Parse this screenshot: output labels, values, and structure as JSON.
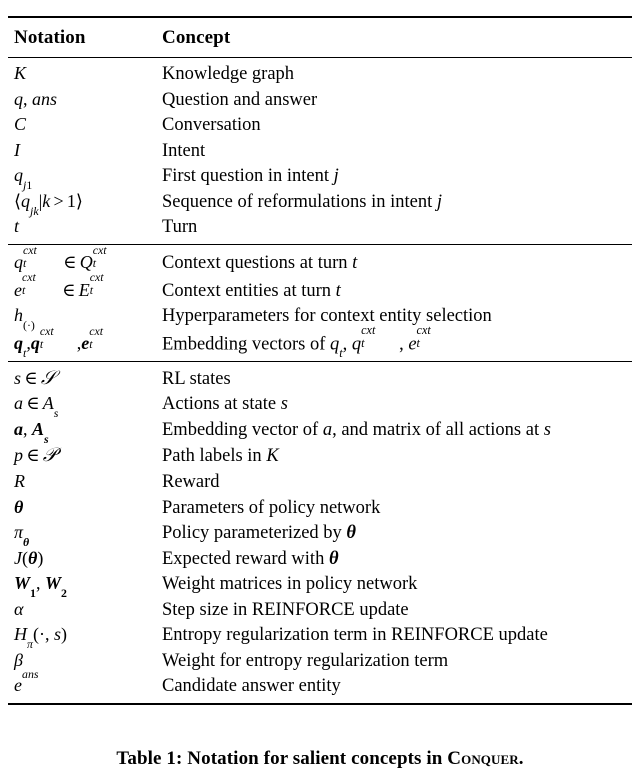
{
  "document": {
    "type": "academic-paper-table",
    "table_label": "Table 1"
  },
  "table": {
    "headers": {
      "notation": "Notation",
      "concept": "Concept"
    },
    "sections": [
      {
        "id": "conversation-basics",
        "rows": [
          {
            "notation_plain": "K",
            "concept": "Knowledge graph"
          },
          {
            "notation_plain": "q, ans",
            "concept": "Question and answer"
          },
          {
            "notation_plain": "C",
            "concept": "Conversation"
          },
          {
            "notation_plain": "I",
            "concept": "Intent"
          },
          {
            "notation_plain": "q_j1",
            "concept_prefix": "First question in intent ",
            "concept_var": "j"
          },
          {
            "notation_plain": "⟨q_jk|k > 1⟩",
            "concept_prefix": "Sequence of reformulations in intent ",
            "concept_var": "j"
          },
          {
            "notation_plain": "t",
            "concept": "Turn"
          }
        ]
      },
      {
        "id": "context-encoding",
        "rows": [
          {
            "notation_plain": "q_t^cxt ∈ Q_t^cxt",
            "concept_prefix": "Context questions at turn ",
            "concept_var": "t"
          },
          {
            "notation_plain": "e_t^cxt ∈ E_t^cxt",
            "concept_prefix": "Context entities at turn ",
            "concept_var": "t"
          },
          {
            "notation_plain": "h_(·)",
            "concept": "Hyperparameters for context entity selection"
          },
          {
            "notation_plain": "q_t, q_t^cxt, e_t^cxt",
            "concept_prefix": "Embedding vectors of ",
            "concept_math": "q_t, q_t^cxt, e_t^cxt"
          }
        ]
      },
      {
        "id": "reinforcement-learning",
        "rows": [
          {
            "notation_plain": "s ∈ S",
            "concept": "RL states"
          },
          {
            "notation_plain": "a ∈ A_s",
            "concept_prefix": "Actions at state ",
            "concept_var": "s"
          },
          {
            "notation_plain": "a, A_s",
            "concept_prefix": "Embedding vector of ",
            "concept_var1": "a",
            "concept_mid": ", and matrix of all actions at ",
            "concept_var2": "s"
          },
          {
            "notation_plain": "p ∈ P",
            "concept_prefix": "Path labels in ",
            "concept_var": "K"
          },
          {
            "notation_plain": "R",
            "concept": "Reward"
          },
          {
            "notation_plain": "θ",
            "concept": "Parameters of policy network"
          },
          {
            "notation_plain": "π_θ",
            "concept_prefix": "Policy parameterized by ",
            "concept_var": "θ"
          },
          {
            "notation_plain": "J(θ)",
            "concept_prefix": "Expected reward with ",
            "concept_var": "θ"
          },
          {
            "notation_plain": "W_1, W_2",
            "concept": "Weight matrices in policy network"
          },
          {
            "notation_plain": "α",
            "concept": "Step size in REINFORCE update"
          },
          {
            "notation_plain": "H_π(·, s)",
            "concept": "Entropy regularization term in REINFORCE update"
          },
          {
            "notation_plain": "β",
            "concept": "Weight for entropy regularization term"
          },
          {
            "notation_plain": "e^ans",
            "concept": "Candidate answer entity"
          }
        ]
      }
    ]
  },
  "caption": {
    "prefix": "Table 1: Notation for salient concepts in ",
    "system_name": "Conquer",
    "suffix": "."
  }
}
